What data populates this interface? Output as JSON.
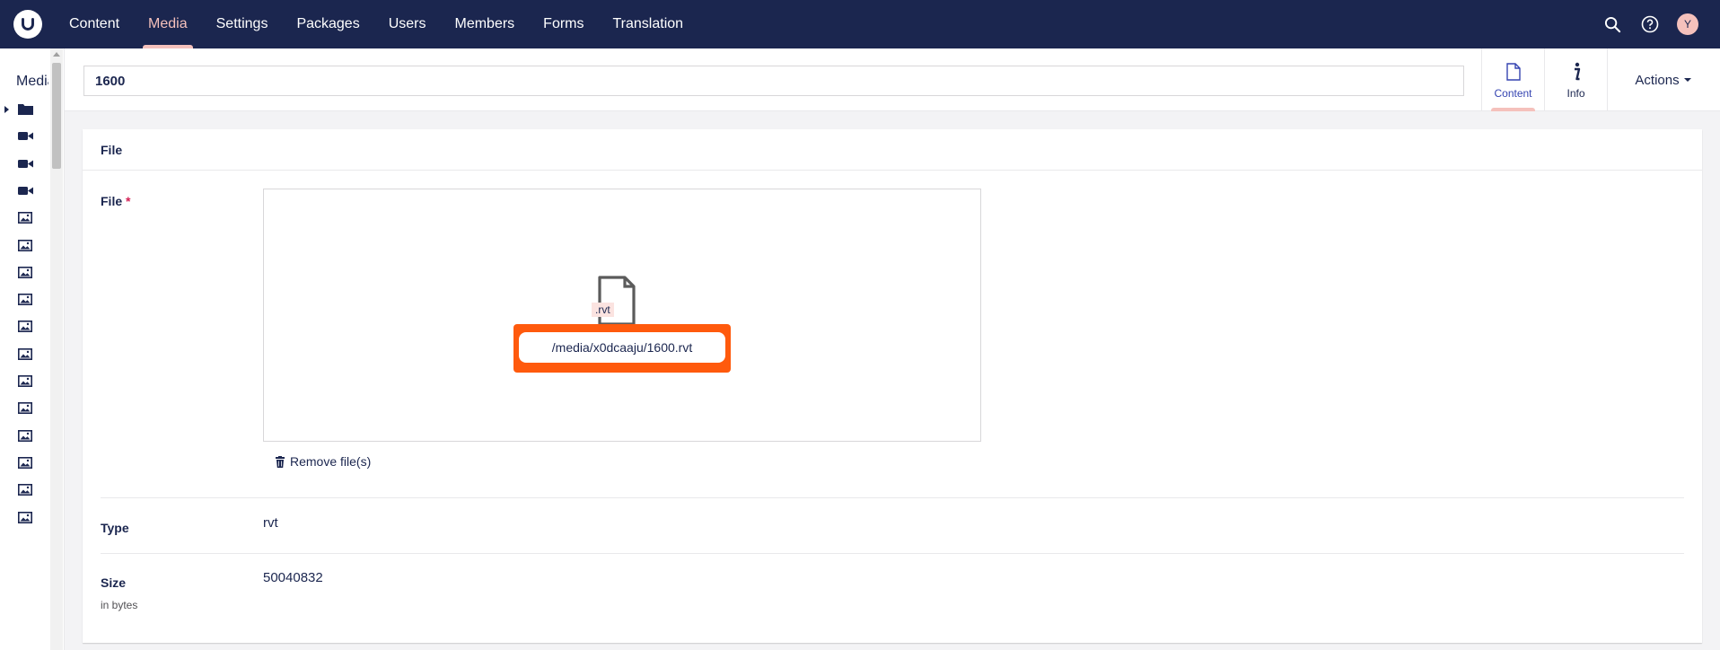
{
  "nav": {
    "items": [
      "Content",
      "Media",
      "Settings",
      "Packages",
      "Users",
      "Members",
      "Forms",
      "Translation"
    ],
    "active": "Media",
    "accent_color": "#f5c1bc",
    "bar_color": "#1b264f",
    "user_initial": "Y"
  },
  "tree": {
    "title": "Media",
    "items": [
      {
        "icon": "folder-icon",
        "caret": true
      },
      {
        "icon": "video-icon"
      },
      {
        "icon": "video-icon"
      },
      {
        "icon": "video-icon"
      },
      {
        "icon": "image-icon"
      },
      {
        "icon": "image-icon"
      },
      {
        "icon": "image-icon"
      },
      {
        "icon": "image-icon"
      },
      {
        "icon": "image-icon"
      },
      {
        "icon": "image-icon"
      },
      {
        "icon": "image-icon"
      },
      {
        "icon": "image-icon"
      },
      {
        "icon": "image-icon"
      },
      {
        "icon": "image-icon"
      },
      {
        "icon": "image-icon"
      },
      {
        "icon": "image-icon"
      }
    ]
  },
  "header": {
    "name_value": "1600",
    "apps": [
      {
        "label": "Content",
        "icon": "document-icon",
        "active": true
      },
      {
        "label": "Info",
        "icon": "info-icon",
        "active": false
      }
    ],
    "actions_label": "Actions"
  },
  "panel": {
    "title": "File",
    "file": {
      "label": "File",
      "required_mark": "*",
      "extension": ".rvt",
      "path": "/media/x0dcaaju/1600.rvt",
      "highlight_color": "#ff5a0d",
      "remove_label": "Remove file(s)"
    },
    "type": {
      "label": "Type",
      "value": "rvt"
    },
    "size": {
      "label": "Size",
      "description": "in bytes",
      "value": "50040832"
    }
  }
}
